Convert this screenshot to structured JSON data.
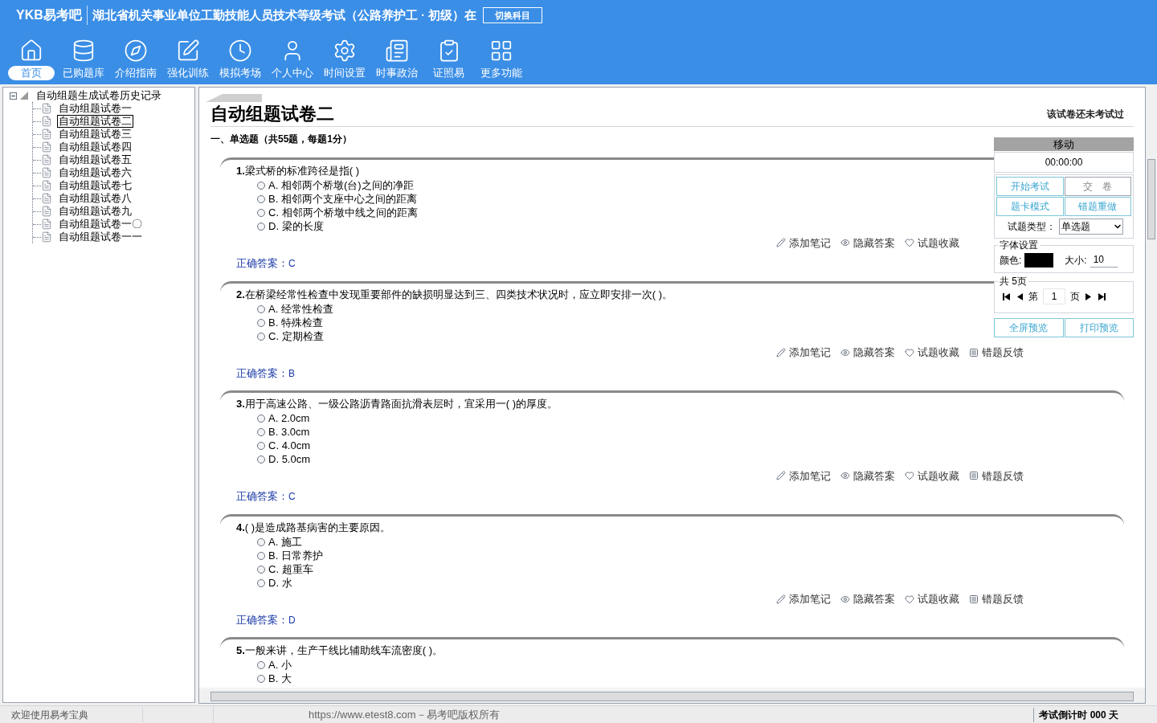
{
  "app": {
    "logo": "YKB易考吧",
    "title": "湖北省机关事业单位工勤技能人员技术等级考试（公路养护工 · 初级）在",
    "switch_button": "切换科目"
  },
  "toolbar": [
    {
      "kind": "home",
      "label": "首页",
      "selected": true
    },
    {
      "kind": "database",
      "label": "已购题库",
      "selected": false
    },
    {
      "kind": "compass",
      "label": "介绍指南",
      "selected": false
    },
    {
      "kind": "edit",
      "label": "强化训练",
      "selected": false
    },
    {
      "kind": "clock",
      "label": "模拟考场",
      "selected": false
    },
    {
      "kind": "user",
      "label": "个人中心",
      "selected": false
    },
    {
      "kind": "gear",
      "label": "时间设置",
      "selected": false
    },
    {
      "kind": "news",
      "label": "时事政治",
      "selected": false
    },
    {
      "kind": "checklist",
      "label": "证照易",
      "selected": false
    },
    {
      "kind": "grid",
      "label": "更多功能",
      "selected": false
    }
  ],
  "tree": {
    "label": "自动组题生成试卷历史记录",
    "expanded": true,
    "children": [
      {
        "label": "自动组题试卷一",
        "selected": false
      },
      {
        "label": "自动组题试卷二",
        "selected": true
      },
      {
        "label": "自动组题试卷三",
        "selected": false
      },
      {
        "label": "自动组题试卷四",
        "selected": false
      },
      {
        "label": "自动组题试卷五",
        "selected": false
      },
      {
        "label": "自动组题试卷六",
        "selected": false
      },
      {
        "label": "自动组题试卷七",
        "selected": false
      },
      {
        "label": "自动组题试卷八",
        "selected": false
      },
      {
        "label": "自动组题试卷九",
        "selected": false
      },
      {
        "label": "自动组题试卷一〇",
        "selected": false
      },
      {
        "label": "自动组题试卷一一",
        "selected": false
      }
    ]
  },
  "paper": {
    "title": "自动组题试卷二",
    "status": "该试卷还未考试过",
    "section": "一、单选题（共55题，每题1分）",
    "questions": [
      {
        "number": "1.",
        "text": "梁式桥的标准跨径是指( )",
        "options": [
          {
            "letter": "A.",
            "text": "相邻两个桥墩(台)之间的净距",
            "selected": false
          },
          {
            "letter": "B.",
            "text": "相邻两个支座中心之间的距离",
            "selected": false
          },
          {
            "letter": "C.",
            "text": "相邻两个桥墩中线之间的距离",
            "selected": false
          },
          {
            "letter": "D.",
            "text": "梁的长度",
            "selected": false
          }
        ],
        "actions": [
          {
            "kind": "note",
            "label": "添加笔记"
          },
          {
            "kind": "hide",
            "label": "隐藏答案"
          },
          {
            "kind": "favorite",
            "label": "试题收藏"
          }
        ],
        "answer_label": "正确答案：",
        "answer": "C"
      },
      {
        "number": "2.",
        "text": "在桥梁经常性检查中发现重要部件的缺损明显达到三、四类技术状况时，应立即安排一次( )。",
        "options": [
          {
            "letter": "A.",
            "text": "经常性检查",
            "selected": false
          },
          {
            "letter": "B.",
            "text": "特殊检查",
            "selected": false
          },
          {
            "letter": "C.",
            "text": "定期检查",
            "selected": false
          }
        ],
        "actions": [
          {
            "kind": "note",
            "label": "添加笔记"
          },
          {
            "kind": "hide",
            "label": "隐藏答案"
          },
          {
            "kind": "favorite",
            "label": "试题收藏"
          },
          {
            "kind": "feedback",
            "label": "错题反馈"
          }
        ],
        "answer_label": "正确答案：",
        "answer": "B"
      },
      {
        "number": "3.",
        "text": "用于高速公路、一级公路沥青路面抗滑表层时，宜采用一( )的厚度。",
        "options": [
          {
            "letter": "A.",
            "text": "2.0cm",
            "selected": false
          },
          {
            "letter": "B.",
            "text": "3.0cm",
            "selected": false
          },
          {
            "letter": "C.",
            "text": "4.0cm",
            "selected": false
          },
          {
            "letter": "D.",
            "text": "5.0cm",
            "selected": false
          }
        ],
        "actions": [
          {
            "kind": "note",
            "label": "添加笔记"
          },
          {
            "kind": "hide",
            "label": "隐藏答案"
          },
          {
            "kind": "favorite",
            "label": "试题收藏"
          },
          {
            "kind": "feedback",
            "label": "错题反馈"
          }
        ],
        "answer_label": "正确答案：",
        "answer": "C"
      },
      {
        "number": "4.",
        "text": "( )是造成路基病害的主要原因。",
        "options": [
          {
            "letter": "A.",
            "text": "施工",
            "selected": false
          },
          {
            "letter": "B.",
            "text": "日常养护",
            "selected": false
          },
          {
            "letter": "C.",
            "text": "超重车",
            "selected": false
          },
          {
            "letter": "D.",
            "text": "水",
            "selected": false
          }
        ],
        "actions": [
          {
            "kind": "note",
            "label": "添加笔记"
          },
          {
            "kind": "hide",
            "label": "隐藏答案"
          },
          {
            "kind": "favorite",
            "label": "试题收藏"
          },
          {
            "kind": "feedback",
            "label": "错题反馈"
          }
        ],
        "answer_label": "正确答案：",
        "answer": "D"
      },
      {
        "number": "5.",
        "text": "一般来讲，生产干线比辅助线车流密度( )。",
        "options": [
          {
            "letter": "A.",
            "text": "小",
            "selected": false
          },
          {
            "letter": "B.",
            "text": "大",
            "selected": false
          }
        ]
      }
    ]
  },
  "panel": {
    "title": "移动",
    "timer": "00:00:00",
    "buttons": [
      "开始考试",
      "交　卷",
      "题卡模式",
      "错题重做"
    ],
    "type_label": "试题类型：",
    "type_value": "单选题",
    "font_group": "字体设置",
    "color_label": "颜色:",
    "color": "#000000",
    "size_label": "大小:",
    "size_value": "10",
    "pages_group": "共 5页",
    "page_prefix": "第",
    "page_value": "1",
    "page_suffix": "页",
    "preview_buttons": [
      "全屏预览",
      "打印预览"
    ]
  },
  "status_bar": {
    "welcome": "欢迎使用易考宝典",
    "copyright": "https://www.etest8.com－易考吧版权所有",
    "countdown": "考试倒计时 000 天"
  }
}
